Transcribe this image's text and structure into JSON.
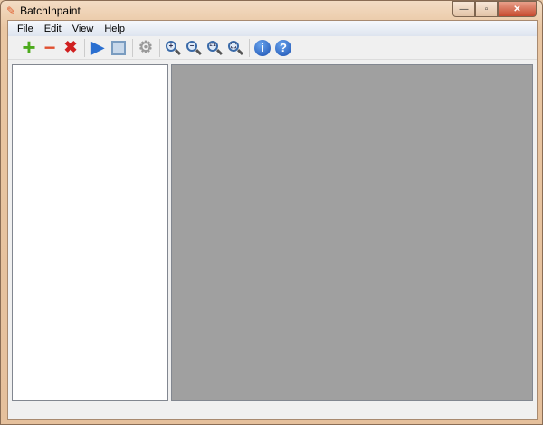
{
  "window": {
    "title": "BatchInpaint",
    "buttons": {
      "minimize": "—",
      "maximize": "▫",
      "close": "✕"
    }
  },
  "menu": [
    "File",
    "Edit",
    "View",
    "Help"
  ],
  "toolbar": {
    "add": "+",
    "remove": "−",
    "clear": "✖",
    "run": "▶",
    "zoom_actual": "1:1",
    "info": "i",
    "help": "?"
  },
  "colors": {
    "preview_bg": "#a0a0a0",
    "titlebar": "#f0d8c0"
  }
}
